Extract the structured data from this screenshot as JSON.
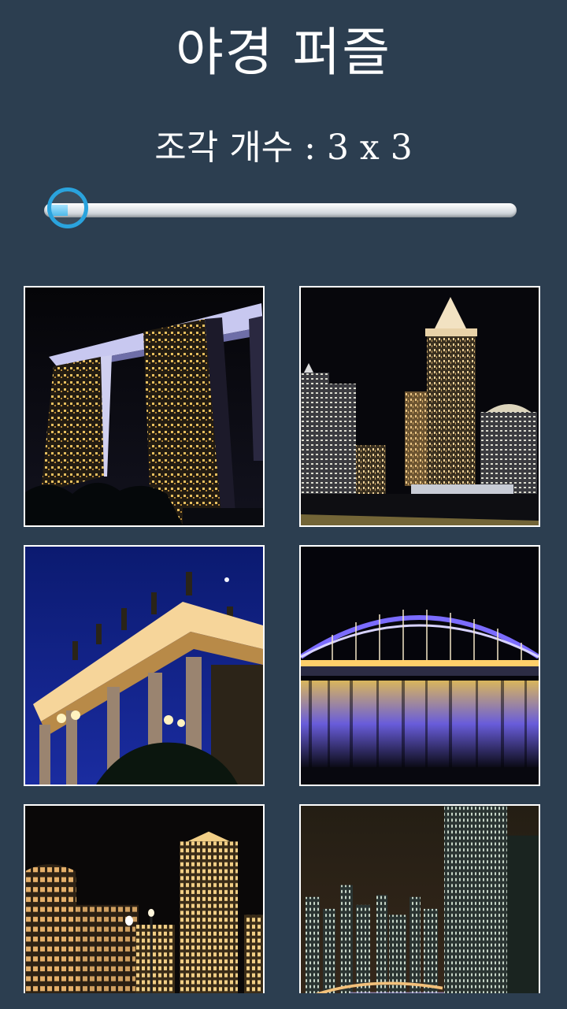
{
  "app": {
    "title": "야경 퍼즐",
    "piece_count_label": "조각 개수 : 3 x 3"
  },
  "slider": {
    "min": 3,
    "max": 10,
    "value": 3,
    "accent_color": "#2aa3dd"
  },
  "colors": {
    "background": "#2c3e50",
    "tile_border": "#ffffff",
    "text": "#ffffff"
  },
  "puzzles": [
    {
      "name": "marina-bay-sands"
    },
    {
      "name": "city-skyscrapers"
    },
    {
      "name": "illuminated-colonnade-building"
    },
    {
      "name": "arch-bridge-reflection"
    },
    {
      "name": "financial-district-towers"
    },
    {
      "name": "city-skyline-tower"
    }
  ]
}
